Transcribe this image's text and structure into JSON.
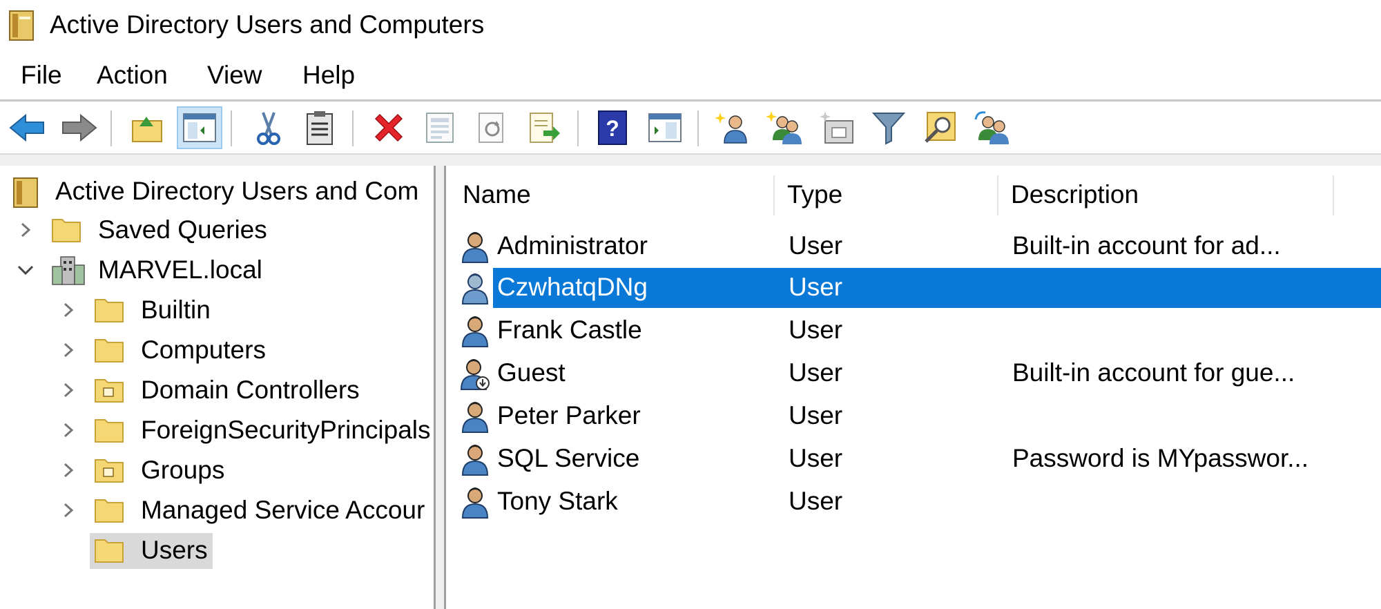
{
  "window": {
    "title": "Active Directory Users and Computers"
  },
  "menu": [
    "File",
    "Action",
    "View",
    "Help"
  ],
  "toolbar": {
    "buttons": [
      "back-icon",
      "forward-icon",
      "up-folder-icon",
      "show-hide-console-tree-icon",
      "cut-icon",
      "paste-icon",
      "delete-icon",
      "properties-icon",
      "refresh-icon",
      "export-list-icon",
      "help-icon",
      "console-tree-icon",
      "new-user-icon",
      "new-group-icon",
      "new-ou-icon",
      "filter-icon",
      "find-icon",
      "add-to-group-icon"
    ]
  },
  "tree": {
    "root": "Active Directory Users and Com",
    "items": [
      {
        "label": "Saved Queries"
      },
      {
        "label": "MARVEL.local"
      },
      {
        "label": "Builtin"
      },
      {
        "label": "Computers"
      },
      {
        "label": "Domain Controllers"
      },
      {
        "label": "ForeignSecurityPrincipals"
      },
      {
        "label": "Groups"
      },
      {
        "label": "Managed Service Accour"
      },
      {
        "label": "Users"
      }
    ]
  },
  "list": {
    "columns": [
      "Name",
      "Type",
      "Description"
    ],
    "rows": [
      {
        "name": "Administrator",
        "type": "User",
        "description": "Built-in account for ad..."
      },
      {
        "name": "CzwhatqDNg",
        "type": "User",
        "description": ""
      },
      {
        "name": "Frank Castle",
        "type": "User",
        "description": ""
      },
      {
        "name": "Guest",
        "type": "User",
        "description": "Built-in account for gue..."
      },
      {
        "name": "Peter Parker",
        "type": "User",
        "description": ""
      },
      {
        "name": "SQL Service",
        "type": "User",
        "description": "Password is MYpasswor..."
      },
      {
        "name": "Tony Stark",
        "type": "User",
        "description": ""
      }
    ],
    "selected_row": "CzwhatqDNg"
  },
  "colors": {
    "selection": "#0a78d7",
    "tree_selection": "#d9d9d9",
    "folder": "#f5d774"
  }
}
